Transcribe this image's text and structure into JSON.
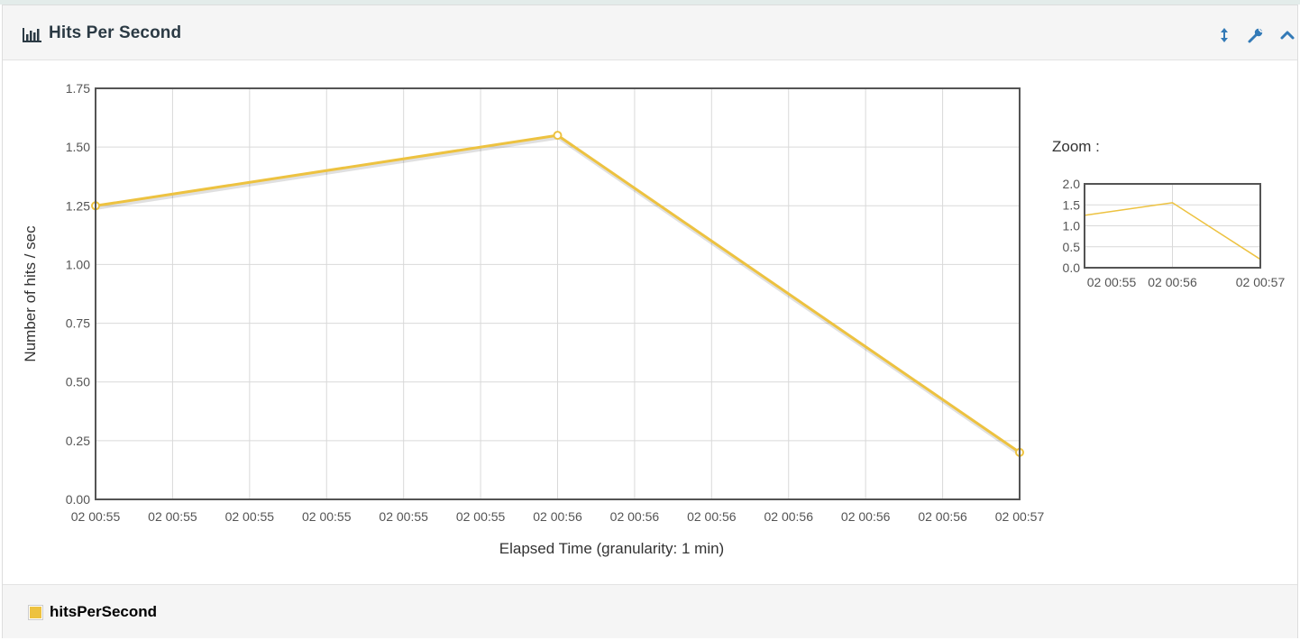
{
  "header": {
    "title": "Hits Per Second",
    "icons": [
      "bar-chart-icon",
      "resize-vertical-icon",
      "wrench-icon",
      "chevron-up-icon"
    ]
  },
  "colors": {
    "series": "#edc240",
    "accent": "#337ab7",
    "axis": "#545454",
    "grid": "#d9d9d9",
    "title": "#2b3a44"
  },
  "zoom": {
    "title": "Zoom :",
    "y_ticks": [
      "2.0",
      "1.5",
      "1.0",
      "0.5",
      "0.0"
    ],
    "x_ticks": [
      "02 00:55",
      "02 00:56",
      "02 00:57"
    ],
    "ylim": [
      0,
      2
    ]
  },
  "chart_data": {
    "type": "line",
    "title": "",
    "xlabel": "Elapsed Time (granularity: 1 min)",
    "ylabel": "Number of hits / sec",
    "ylim": [
      0,
      1.75
    ],
    "y_ticks": [
      "0.00",
      "0.25",
      "0.50",
      "0.75",
      "1.00",
      "1.25",
      "1.50",
      "1.75"
    ],
    "x_ticks": [
      "02 00:55",
      "02 00:55",
      "02 00:55",
      "02 00:55",
      "02 00:55",
      "02 00:55",
      "02 00:56",
      "02 00:56",
      "02 00:56",
      "02 00:56",
      "02 00:56",
      "02 00:56",
      "02 00:57"
    ],
    "x": [
      "02 00:55",
      "02 00:56",
      "02 00:57"
    ],
    "series": [
      {
        "name": "hitsPerSecond",
        "values": [
          1.25,
          1.55,
          0.2
        ]
      }
    ],
    "grid": true,
    "legend": "bottom-left"
  }
}
